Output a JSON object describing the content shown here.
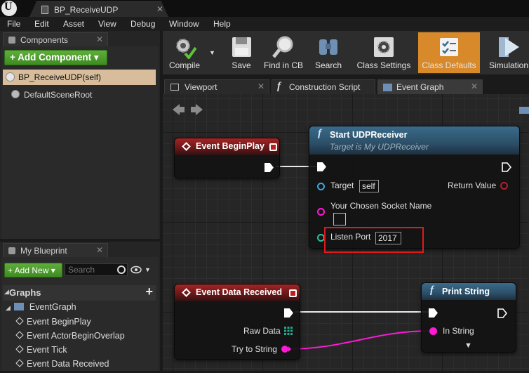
{
  "window": {
    "tab_title": "BP_ReceiveUDP",
    "tab_close": "✕",
    "logo_letter": "U"
  },
  "menu": [
    "File",
    "Edit",
    "Asset",
    "View",
    "Debug",
    "Window",
    "Help"
  ],
  "components_panel": {
    "tab_label": "Components",
    "add_button": "+ Add Component ▾",
    "items": [
      "BP_ReceiveUDP(self)",
      "DefaultSceneRoot"
    ]
  },
  "my_blueprint_panel": {
    "tab_label": "My Blueprint",
    "add_new": "+ Add New ▾",
    "search_placeholder": "Search",
    "graphs_header": "Graphs",
    "event_graph": "EventGraph",
    "events": [
      "Event BeginPlay",
      "Event ActorBeginOverlap",
      "Event Tick",
      "Event Data Received"
    ]
  },
  "toolbar": {
    "buttons": [
      "Compile",
      "Save",
      "Find in CB",
      "Search",
      "Class Settings",
      "Class Defaults",
      "Simulation"
    ],
    "active": "Class Defaults",
    "active_color": "#d8892a"
  },
  "editor_tabs": [
    "Viewport",
    "Construction Script",
    "Event Graph"
  ],
  "graph": {
    "begin_play": {
      "title": "Event BeginPlay"
    },
    "start_receiver": {
      "title": "Start UDPReceiver",
      "subtitle": "Target is My UDPReceiver",
      "target_label": "Target",
      "target_value": "self",
      "return_label": "Return Value",
      "socket_label": "Your Chosen Socket Name",
      "port_label": "Listen Port",
      "port_value": "2017"
    },
    "data_received": {
      "title": "Event Data Received",
      "raw_data_label": "Raw Data",
      "string_label": "Try to String"
    },
    "print_string": {
      "title": "Print String",
      "in_string_label": "In String"
    },
    "colors": {
      "event_header": "#a52424",
      "function_header": "#3a6b8a",
      "string_pin": "#ff1ad8",
      "object_pin": "#3fa7e0",
      "highlight": "#e01a1a"
    }
  }
}
